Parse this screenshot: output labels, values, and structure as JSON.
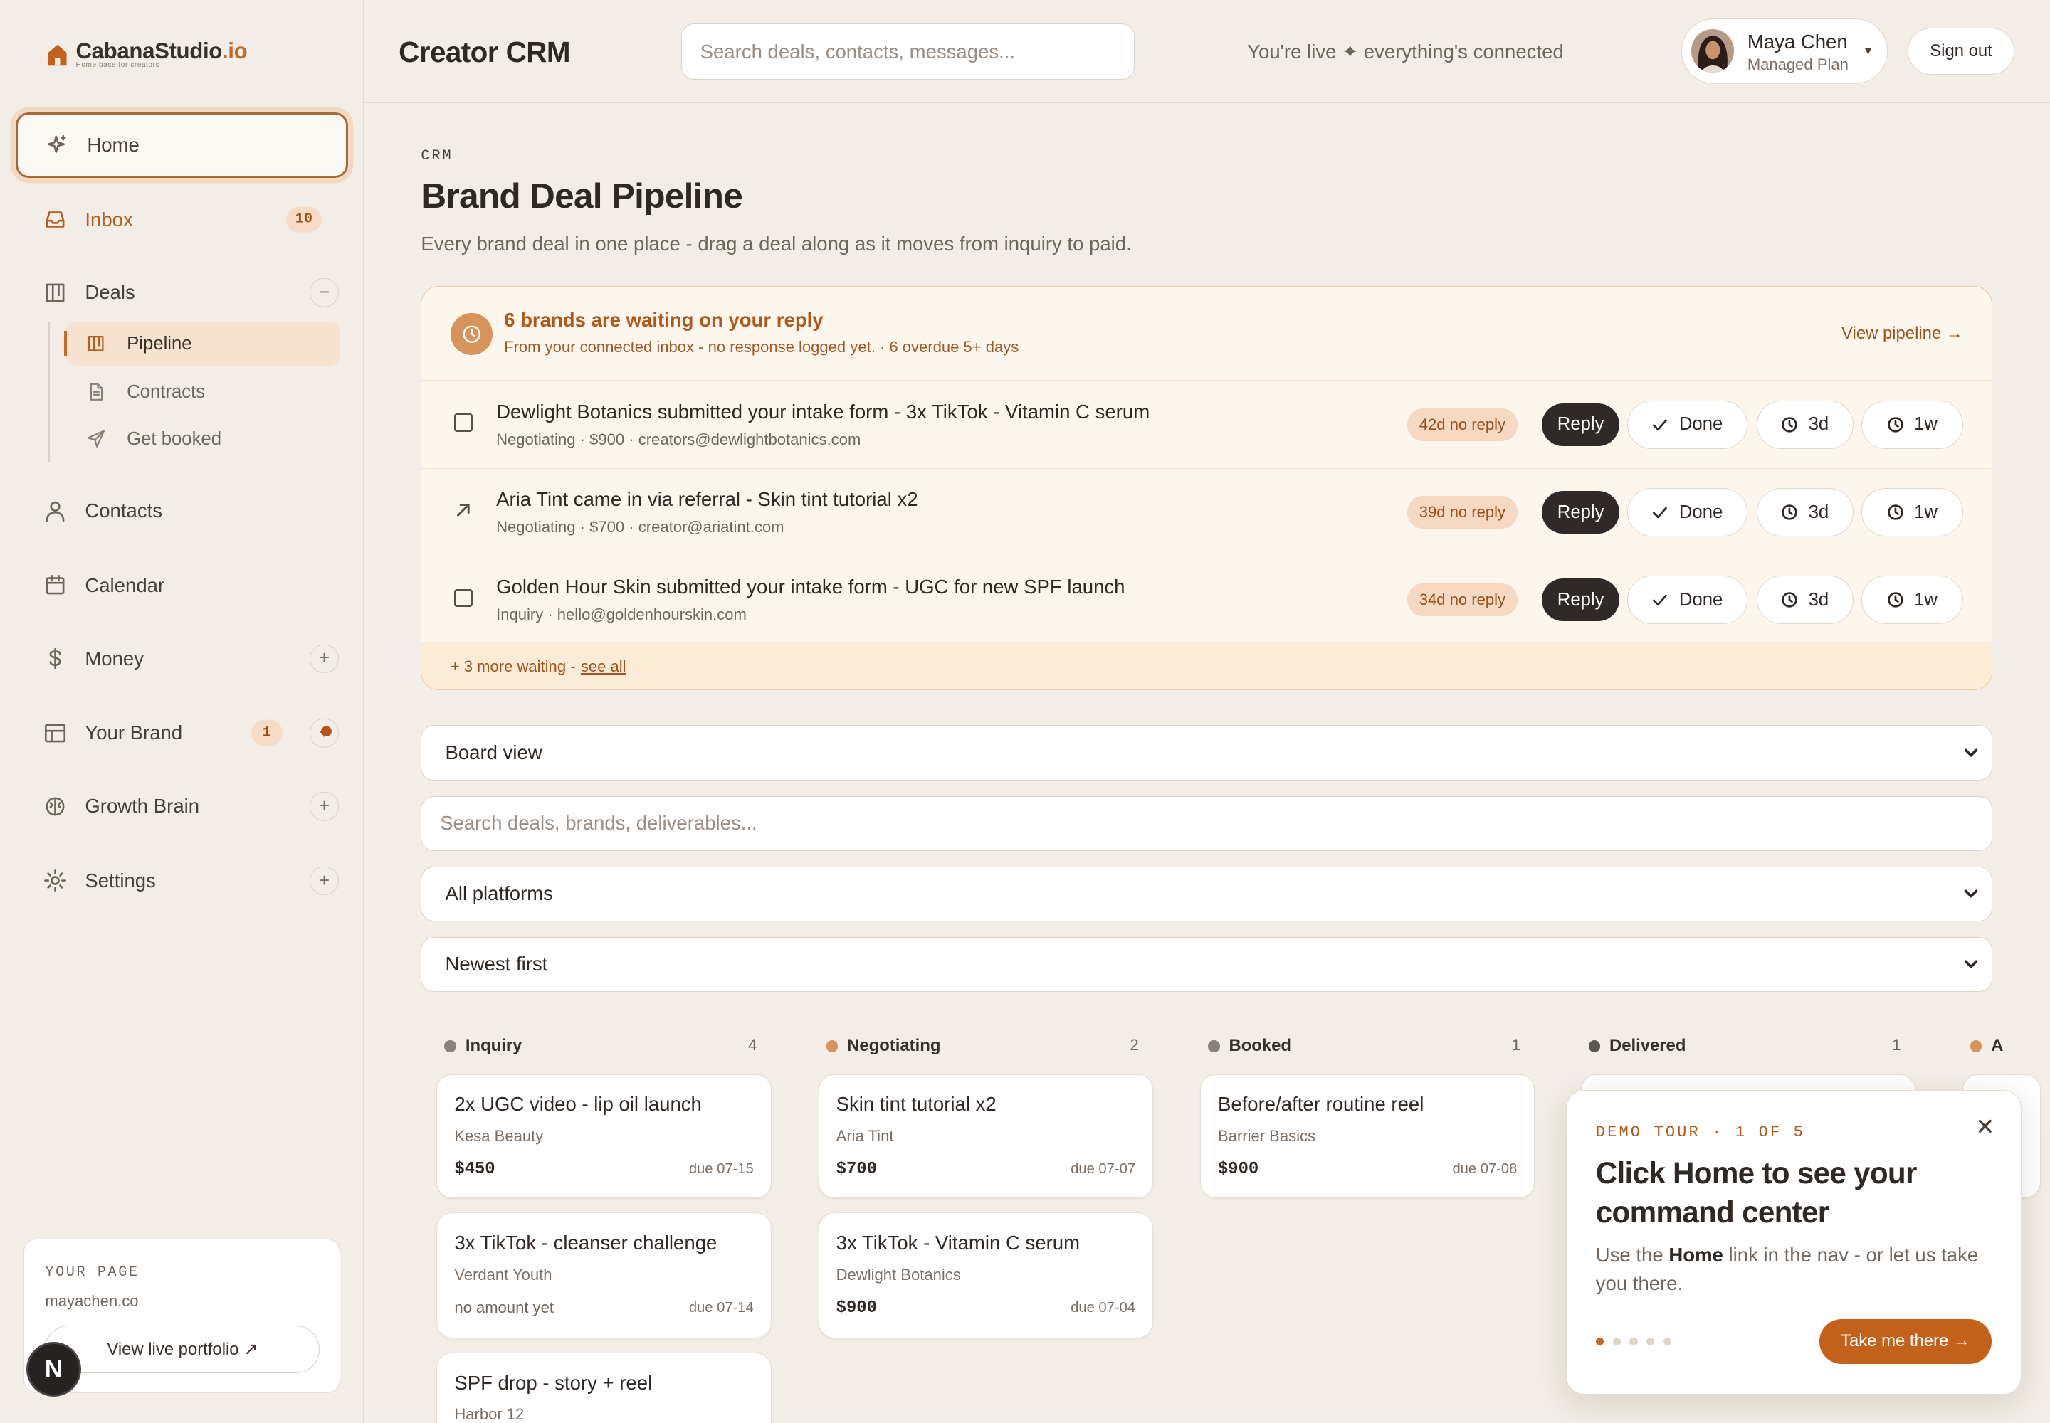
{
  "brand": {
    "name_main": "CabanaStudio",
    "name_tld": ".io",
    "tagline": "Home base for creators"
  },
  "sidebar": {
    "home": "Home",
    "inbox": {
      "label": "Inbox",
      "badge": "10"
    },
    "deals": {
      "label": "Deals",
      "toggle": "−"
    },
    "sub": {
      "pipeline": "Pipeline",
      "contracts": "Contracts",
      "get_booked": "Get booked"
    },
    "contacts": "Contacts",
    "calendar": "Calendar",
    "money": {
      "label": "Money",
      "toggle": "+"
    },
    "your_brand": {
      "label": "Your Brand",
      "badge": "1",
      "toggle": "+"
    },
    "growth_brain": {
      "label": "Growth Brain",
      "toggle": "+"
    },
    "settings": {
      "label": "Settings",
      "toggle": "+"
    },
    "your_page": {
      "label": "YOUR PAGE",
      "url": "mayachen.co",
      "button": "View live portfolio ↗"
    },
    "n_badge": "N"
  },
  "header": {
    "title": "Creator CRM",
    "search_placeholder": "Search deals, contacts, messages...",
    "status": "You're live ✦ everything's connected",
    "user": {
      "name": "Maya Chen",
      "plan": "Managed Plan",
      "caret": "▾"
    },
    "sign_out": "Sign out"
  },
  "page": {
    "eyebrow": "CRM",
    "title": "Brand Deal Pipeline",
    "subtitle": "Every brand deal in one place - drag a deal along as it moves from inquiry to paid."
  },
  "waiting": {
    "title": "6 brands are waiting on your reply",
    "subtitle": "From your connected inbox - no response logged yet. · 6 overdue 5+ days",
    "link": "View pipeline →",
    "rows": [
      {
        "brand": "Dewlight Botanics",
        "text": " submitted your intake form - 3x TikTok - Vitamin C serum",
        "meta": "Negotiating · $900 · creators@dewlightbotanics.com",
        "ago": "42d no reply"
      },
      {
        "brand": "Aria Tint",
        "text": " came in via referral - Skin tint tutorial x2",
        "meta": "Negotiating · $700 · creator@ariatint.com",
        "ago": "39d no reply"
      },
      {
        "brand": "Golden Hour Skin",
        "text": " submitted your intake form - UGC for new SPF launch",
        "meta": "Inquiry · hello@goldenhourskin.com",
        "ago": "34d no reply"
      }
    ],
    "actions": {
      "reply": "Reply",
      "done": "Done",
      "snooze_short": "3d",
      "snooze_long": "1w"
    },
    "more_text": "+ 3 more waiting - ",
    "more_link": "see all"
  },
  "controls": {
    "view": "Board view",
    "search_placeholder": "Search deals, brands, deliverables...",
    "platform": "All platforms",
    "sort": "Newest first"
  },
  "board": {
    "columns": [
      {
        "name": "Inquiry",
        "count": "4",
        "color": "#8a817a"
      },
      {
        "name": "Negotiating",
        "count": "2",
        "color": "#d6935a"
      },
      {
        "name": "Booked",
        "count": "1",
        "color": "#8a817a"
      },
      {
        "name": "Delivered",
        "count": "1",
        "color": "#5e5651"
      },
      {
        "name": "A",
        "color": "#d6935a"
      }
    ],
    "cards": {
      "inquiry": [
        {
          "title": "2x UGC video - lip oil launch",
          "brand": "Kesa Beauty",
          "amount": "$450",
          "due": "due 07-15"
        },
        {
          "title": "3x TikTok - cleanser challenge",
          "brand": "Verdant Youth",
          "amount": "no amount yet",
          "due": "due 07-14"
        },
        {
          "title": "SPF drop - story + reel",
          "brand": "Harbor 12"
        }
      ],
      "negotiating": [
        {
          "title": "Skin tint tutorial x2",
          "brand": "Aria Tint",
          "amount": "$700",
          "due": "due 07-07"
        },
        {
          "title": "3x TikTok - Vitamin C serum",
          "brand": "Dewlight Botanics",
          "amount": "$900",
          "due": "due 07-04"
        }
      ],
      "booked": [
        {
          "title": "Before/after routine reel",
          "brand": "Barrier Basics",
          "amount": "$900",
          "due": "due 07-08"
        }
      ]
    }
  },
  "tour": {
    "eyebrow": "DEMO TOUR · 1 OF 5",
    "title": "Click Home to see your command center",
    "body_pre": "Use the ",
    "body_bold": "Home",
    "body_post": " link in the nav - or let us take you there.",
    "close": "×",
    "button": "Take me there →",
    "step": 1,
    "steps_total": 5
  },
  "colors": {
    "accent": "#c4621c",
    "background": "#f2ede6",
    "alert_bg": "#fdf6ec",
    "dark_button": "#2f2a28"
  }
}
